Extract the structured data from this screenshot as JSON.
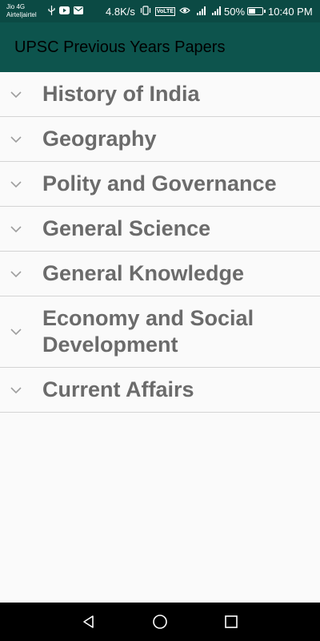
{
  "status_bar": {
    "carrier_line1": "Jio 4G",
    "carrier_line2": "Airtel|airtel",
    "network_speed": "4.8K/s",
    "volte_badge": "VoLTE",
    "battery_percent": "50%",
    "battery_level": 0.5,
    "time": "10:40 PM"
  },
  "app_bar": {
    "title": "UPSC Previous Years Papers"
  },
  "categories": [
    {
      "label": "History of India"
    },
    {
      "label": "Geography"
    },
    {
      "label": "Polity and Governance"
    },
    {
      "label": "General Science"
    },
    {
      "label": "General Knowledge"
    },
    {
      "label": "Economy and Social Development"
    },
    {
      "label": "Current Affairs"
    }
  ],
  "colors": {
    "status_bar": "#0b4a44",
    "app_bar": "#0d544d",
    "item_text": "#6b6b6b",
    "divider": "#d4d4d4",
    "background": "#fafafa"
  },
  "icons": {
    "expand": "chevron-down-icon",
    "nav_back": "back-triangle-icon",
    "nav_home": "home-circle-icon",
    "nav_recents": "recents-square-icon"
  }
}
